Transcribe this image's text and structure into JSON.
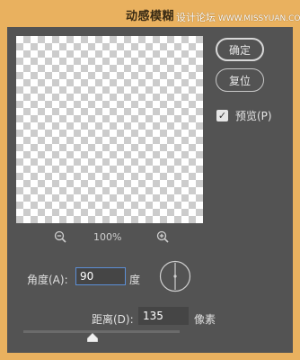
{
  "window": {
    "title": "动感模糊",
    "watermark_cn": "设计论坛",
    "watermark_en": "WWW.MISSYUAN.COM"
  },
  "buttons": {
    "ok_label": "确定",
    "reset_label": "复位"
  },
  "preview_checkbox": {
    "label": "预览(P)",
    "checked": true
  },
  "zoom": {
    "value": "100%",
    "zoom_out_icon": "zoom-out-icon",
    "zoom_in_icon": "zoom-in-icon"
  },
  "angle": {
    "label": "角度(A):",
    "value": "90",
    "unit": "度"
  },
  "distance": {
    "label": "距离(D):",
    "value": "135",
    "unit": "像素",
    "slider_fraction": 0.44
  },
  "colors": {
    "titlebar": "#e9b15f",
    "panel": "#535353",
    "input_focus_border": "#5c8fd6"
  }
}
